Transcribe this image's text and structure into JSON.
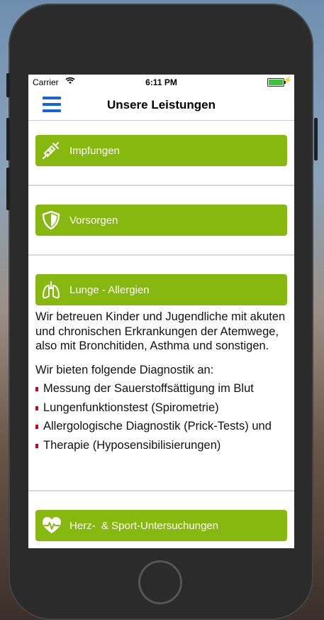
{
  "status_bar": {
    "carrier": "Carrier",
    "time": "6:11 PM"
  },
  "navbar": {
    "title": "Unsere Leistungen"
  },
  "sections": [
    {
      "label": "Impfungen",
      "icon": "syringe-icon"
    },
    {
      "label": "Vorsorgen",
      "icon": "shield-icon"
    },
    {
      "label": "Lunge - Allergien",
      "icon": "lungs-icon",
      "description": "Wir betreuen Kinder und Jugendliche mit akuten und chronischen Erkrankungen der Atemwege, also mit Bronchitiden, Asthma und sonstigen.",
      "diagnostics_heading": "Wir bieten folgende Diagnostik an:",
      "diagnostics": [
        "Messung der Sauerstoffsättigung im Blut",
        "Lungenfunktionstest (Spirometrie)",
        "Allergologische Diagnostik (Prick-Tests) und",
        "Therapie (Hyposensibilisierungen)"
      ]
    },
    {
      "label": "Herz-  & Sport-Untersuchungen",
      "icon": "heart-pulse-icon"
    }
  ],
  "colors": {
    "accent": "#87b80f",
    "menu": "#1565d8",
    "bullet": "#d0021b"
  }
}
